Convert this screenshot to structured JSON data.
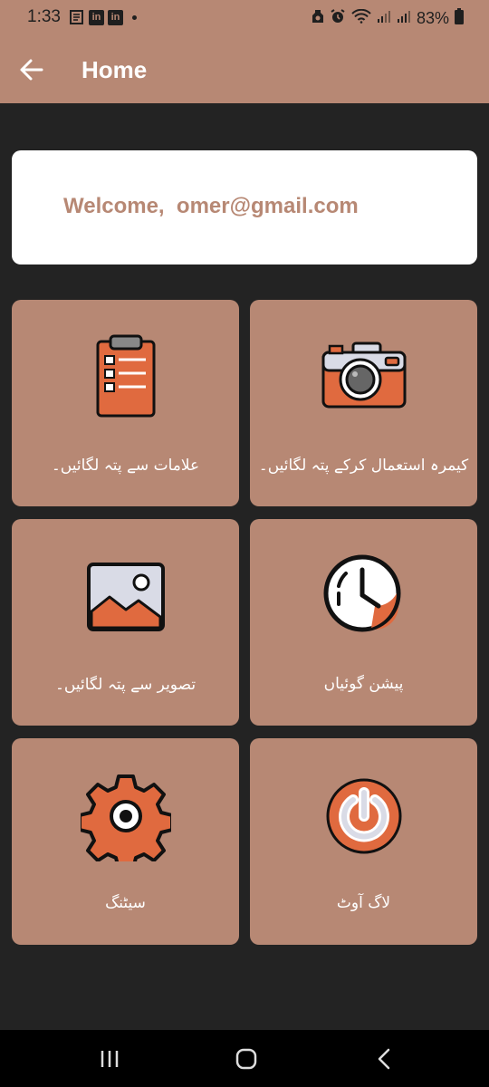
{
  "status_bar": {
    "time": "1:33",
    "notification_icons": [
      "news-icon",
      "linkedin-icon",
      "linkedin-icon"
    ],
    "li_text": "in",
    "battery": "83%"
  },
  "app_bar": {
    "title": "Home",
    "back_icon": "arrow-left-icon"
  },
  "welcome": {
    "text": "Welcome,  omer@gmail.com"
  },
  "tiles": [
    {
      "label": "علامات سے پتہ لگائیں۔",
      "icon": "clipboard-checklist-icon"
    },
    {
      "label": "کیمرہ استعمال کرکے پتہ لگائیں۔",
      "icon": "camera-icon"
    },
    {
      "label": "تصویر سے پتہ لگائیں۔",
      "icon": "image-icon"
    },
    {
      "label": "پیشن گوئیاں",
      "icon": "clock-icon"
    },
    {
      "label": "سیٹنگ",
      "icon": "gear-icon"
    },
    {
      "label": "لاگ آوٹ",
      "icon": "power-icon"
    }
  ],
  "nav_bar": {
    "buttons": [
      "recents-icon",
      "home-icon",
      "back-icon"
    ]
  },
  "colors": {
    "accent": "#b78874",
    "background": "#232323",
    "icon_orange": "#e06a3f",
    "card": "#ffffff"
  }
}
